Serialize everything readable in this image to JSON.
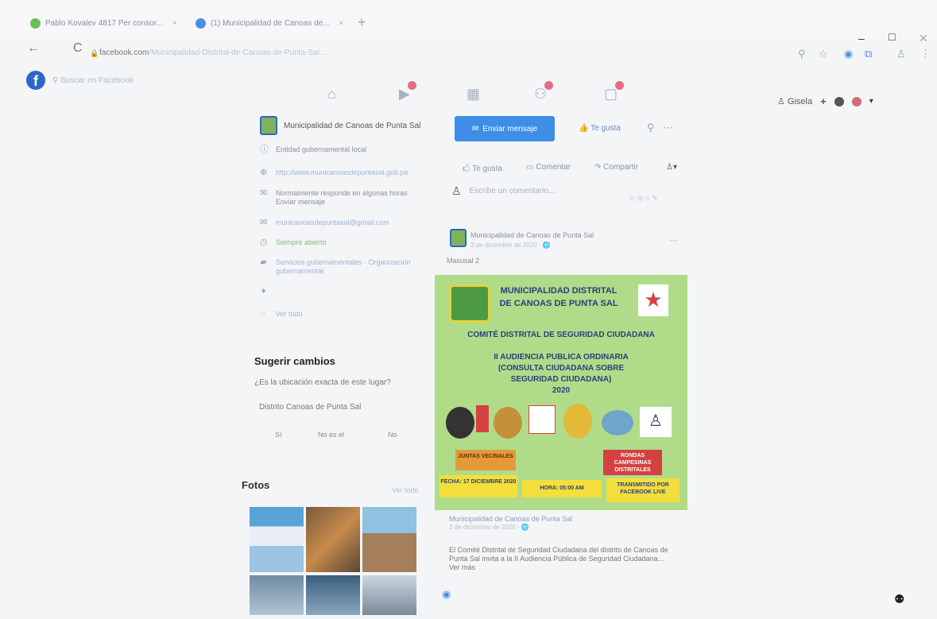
{
  "browser": {
    "tabs": [
      {
        "label": "Pablo Kovalev 4817 Per consor..."
      },
      {
        "label": "(1) Municipalidad de Canoas de..."
      }
    ],
    "new_tab": "+",
    "window_controls": {
      "minimize": "–",
      "maximize": "□",
      "close": "✕"
    },
    "back": "←",
    "reload": "C",
    "url_host": "facebook.com",
    "url_path": "/Municipalidad-Distrital-de-Canoas-de-Punta-Sal..."
  },
  "facebook": {
    "logo": "f",
    "search_placeholder": "Buscar en Facebook",
    "profile_name": "Gisela",
    "profile_plus": "+"
  },
  "page_info": {
    "page_name": "Municipalidad de Canoas de Punta Sal",
    "rows": [
      {
        "icon": "info-icon",
        "text": "Entidad gubernamental local"
      },
      {
        "icon": "link-icon",
        "text": "http://www.municanoasdepuntasal.gob.pe"
      },
      {
        "icon": "messenger-icon",
        "text": "Normalmente responde en algunas horas Enviar mensaje"
      },
      {
        "icon": "email-icon",
        "text": "municanoasdepuntasal@gmail.com"
      },
      {
        "icon": "clock-icon",
        "text": "Siempre abierto"
      },
      {
        "icon": "folder-icon",
        "text": "Servicios gubernamentales · Organización gubernamental"
      },
      {
        "icon": "twitter-icon",
        "text": ""
      },
      {
        "icon": "globe-icon",
        "text": "Ver todo"
      }
    ]
  },
  "suggest": {
    "title": "Sugerir cambios",
    "question": "¿Es la ubicación exacta de este lugar?",
    "place": "Distrito Canoas de Punta Sal",
    "buttons": [
      "Sí",
      "No es el",
      "No"
    ]
  },
  "fotos": {
    "title": "Fotos",
    "see_all": "Ver todo"
  },
  "actions": {
    "message_button": "Enviar mensaje",
    "like_button": "Te gusta",
    "tabs": [
      "Te gusta",
      "Comentar",
      "Compartir"
    ]
  },
  "composer": {
    "placeholder": "Escribe un comentario...",
    "icons": "☺ ◎ ⌂ ✎"
  },
  "post": {
    "author": "Municipalidad de Canoas de Punta Sal",
    "date": "3 de diciembre de 2020 · 🌐",
    "text": "Masusal 2"
  },
  "poster": {
    "line1": "MUNICIPALIDAD DISTRITAL",
    "line2": "DE CANOAS DE PUNTA SAL",
    "committee": "COMITÉ DISTRITAL DE SEGURIDAD CIUDADANA",
    "heading1": "II AUDIENCIA PUBLICA ORDINARIA",
    "heading2": "(CONSULTA CIUDADANA SOBRE",
    "heading3": "SEGURIDAD CIUDADANA)",
    "year": "2020",
    "box_left": "JUNTAS VECINALES",
    "box_right": "RONDAS CAMPESINAS DISTRITALES",
    "date_box": "FECHA: 17 DICIEMBRE 2020",
    "time_box": "HORA: 05:00 AM",
    "broadcast_box": "TRANSMITIDO POR FACEBOOK LIVE"
  },
  "caption": {
    "author": "Municipalidad de Canoas de Punta Sal",
    "date": "3 de diciembre de 2020 · 🌐",
    "text": "El Comité Distrital de Seguridad Ciudadana del distrito de Canoas de Punta Sal invita a la II Audiencia Pública de Seguridad Ciudadana... Ver más"
  },
  "colors": {
    "fb_blue": "#2d66c9",
    "message_blue": "#3f8ee6",
    "poster_green": "#b0dc8a",
    "poster_orange": "#e59a3a",
    "poster_red": "#d54141",
    "poster_yellow": "#f4de3c",
    "badge_pink": "#e56d83"
  }
}
